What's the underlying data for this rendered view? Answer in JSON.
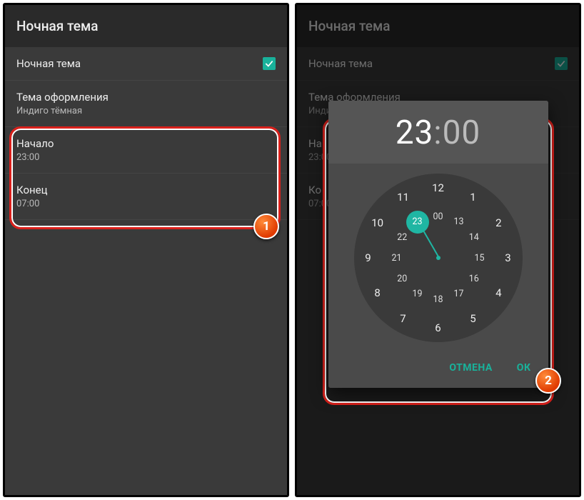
{
  "accent": "#19b29b",
  "left": {
    "title": "Ночная тема",
    "toggle_row": {
      "label": "Ночная тема",
      "checked": true
    },
    "theme_row": {
      "label": "Тема оформления",
      "value": "Индиго тёмная"
    },
    "start_row": {
      "label": "Начало",
      "value": "23:00"
    },
    "end_row": {
      "label": "Конец",
      "value": "07:00"
    },
    "callout": "1"
  },
  "right": {
    "title": "Ночная тема",
    "toggle_row": {
      "label": "Ночная тема",
      "checked": true
    },
    "theme_row": {
      "label": "Тема оформления",
      "value": "Инди"
    },
    "start_row": {
      "label": "На",
      "value": "23:00"
    },
    "end_row": {
      "label": "Ко",
      "value": "07:00"
    },
    "dialog": {
      "hour": "23",
      "minute": "00",
      "outer_hours": [
        "12",
        "1",
        "2",
        "3",
        "4",
        "5",
        "6",
        "7",
        "8",
        "9",
        "10",
        "11"
      ],
      "inner_hours": [
        "00",
        "13",
        "14",
        "15",
        "16",
        "17",
        "18",
        "19",
        "20",
        "21",
        "22",
        "23"
      ],
      "selected_inner_index": 11,
      "cancel": "ОТМЕНА",
      "ok": "ОК"
    },
    "callout": "2"
  }
}
